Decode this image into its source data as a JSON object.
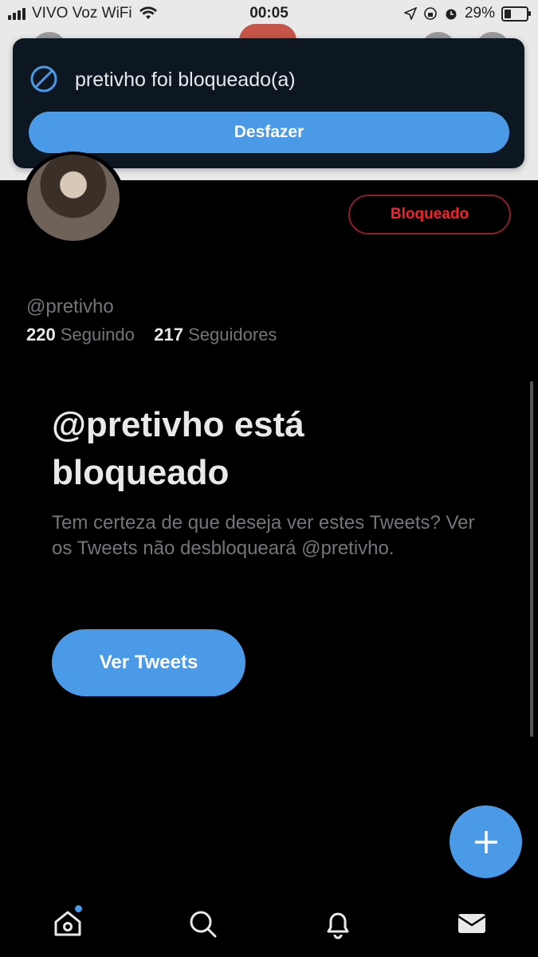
{
  "status_bar": {
    "carrier": "VIVO Voz WiFi",
    "time": "00:05",
    "battery_percent": "29%",
    "battery_level": 0.29
  },
  "toast": {
    "message": "pretivho foi bloqueado(a)",
    "undo_label": "Desfazer",
    "icon": "block-icon"
  },
  "profile": {
    "blocked_label": "Bloqueado",
    "handle": "@pretivho",
    "following_count": "220",
    "following_label": "Seguindo",
    "followers_count": "217",
    "followers_label": "Seguidores"
  },
  "blocked_notice": {
    "title": "@pretivho está bloqueado",
    "description": "Tem certeza de que deseja ver estes Tweets? Ver os Tweets não desbloqueará @pretivho.",
    "view_label": "Ver Tweets"
  },
  "tabs": [
    "home-icon",
    "search-icon",
    "bell-icon",
    "mail-icon"
  ],
  "colors": {
    "accent": "#4a9ae8",
    "danger": "#f4212e",
    "background": "#000000"
  }
}
